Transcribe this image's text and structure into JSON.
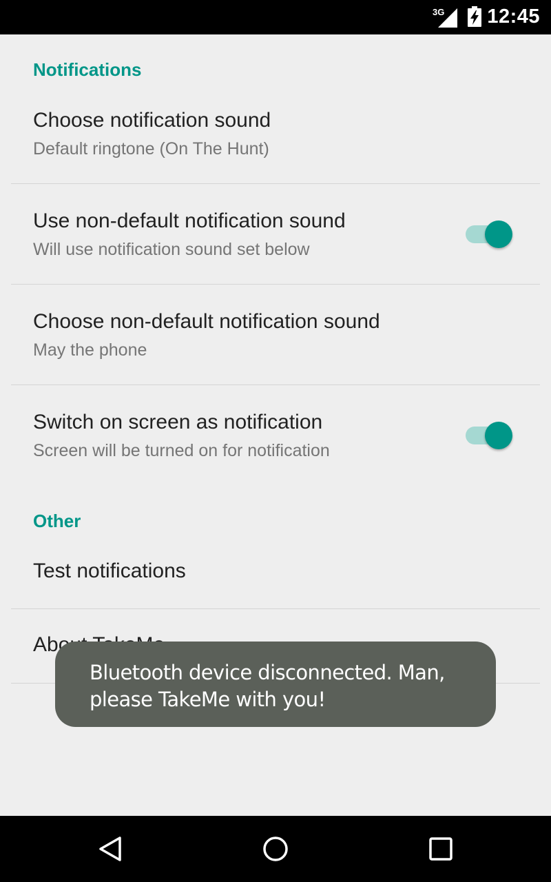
{
  "status_bar": {
    "network": "3G",
    "time": "12:45",
    "signal_icon": "cell-signal-icon",
    "battery_icon": "battery-charging-icon"
  },
  "sections": {
    "notifications": {
      "header": "Notifications",
      "items": [
        {
          "title": "Choose notification sound",
          "summary": "Default ringtone (On The Hunt)"
        },
        {
          "title": "Use non-default notification sound",
          "summary": "Will use notification sound set below",
          "switch_on": true
        },
        {
          "title": "Choose non-default notification sound",
          "summary": "May the phone"
        },
        {
          "title": "Switch on screen as notification",
          "summary": "Screen will be turned on for notification",
          "switch_on": true
        }
      ]
    },
    "other": {
      "header": "Other",
      "items": [
        {
          "title": "Test notifications"
        },
        {
          "title": "About TakeMe"
        }
      ]
    }
  },
  "toast": {
    "message": "Bluetooth device disconnected. Man, please TakeMe with you!"
  },
  "nav_bar": {
    "back_icon": "back-icon",
    "home_icon": "home-icon",
    "recents_icon": "recents-icon"
  },
  "colors": {
    "accent": "#009688",
    "switch_track": "#a5d8d2",
    "background": "#eeeeee",
    "toast_bg": "#5b6059"
  }
}
